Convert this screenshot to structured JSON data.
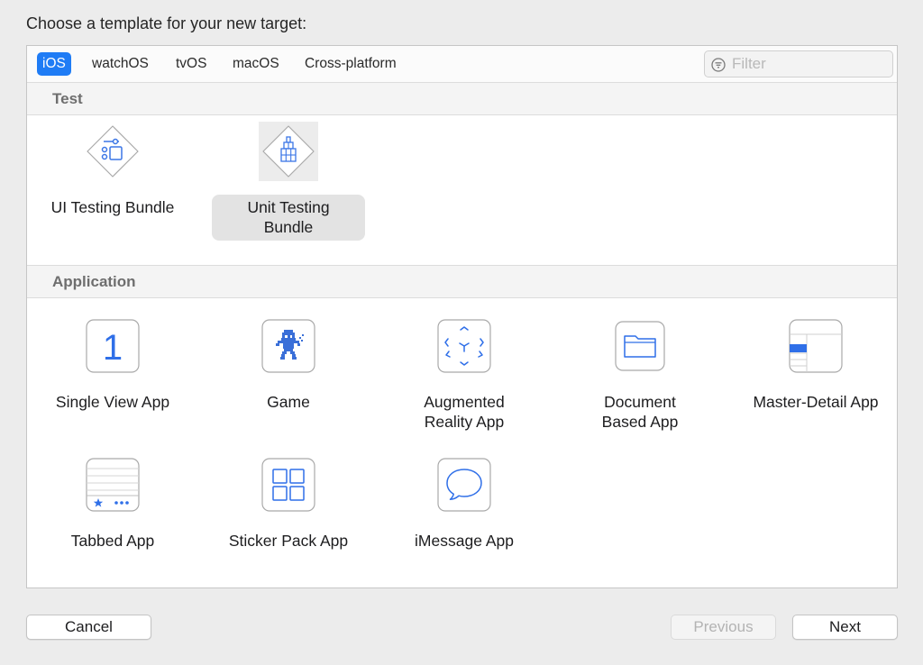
{
  "heading": "Choose a template for your new target:",
  "tabs": [
    {
      "label": "iOS",
      "selected": true
    },
    {
      "label": "watchOS",
      "selected": false
    },
    {
      "label": "tvOS",
      "selected": false
    },
    {
      "label": "macOS",
      "selected": false
    },
    {
      "label": "Cross-platform",
      "selected": false
    }
  ],
  "filter": {
    "placeholder": "Filter",
    "value": "",
    "icon": "filter-icon"
  },
  "sections": [
    {
      "title": "Test",
      "templates": [
        {
          "line1": "UI Testing Bundle",
          "line2": "",
          "icon": "ui-testing-bundle-icon",
          "selected": false
        },
        {
          "line1": "Unit Testing",
          "line2": "Bundle",
          "icon": "unit-testing-bundle-icon",
          "selected": true
        }
      ]
    },
    {
      "title": "Application",
      "templates": [
        {
          "line1": "Single View App",
          "line2": "",
          "icon": "single-view-app-icon",
          "icon_text": "1"
        },
        {
          "line1": "Game",
          "line2": "",
          "icon": "game-icon"
        },
        {
          "line1": "Augmented",
          "line2": "Reality App",
          "icon": "augmented-reality-app-icon"
        },
        {
          "line1": "Document",
          "line2": "Based App",
          "icon": "document-based-app-icon"
        },
        {
          "line1": "Master-Detail App",
          "line2": "",
          "icon": "master-detail-app-icon"
        },
        {
          "line1": "Tabbed App",
          "line2": "",
          "icon": "tabbed-app-icon"
        },
        {
          "line1": "Sticker Pack App",
          "line2": "",
          "icon": "sticker-pack-app-icon"
        },
        {
          "line1": "iMessage App",
          "line2": "",
          "icon": "imessage-app-icon"
        }
      ]
    }
  ],
  "buttons": {
    "cancel": "Cancel",
    "previous": "Previous",
    "next": "Next",
    "previous_enabled": false
  },
  "colors": {
    "accent": "#1f7cf5",
    "icon_blue": "#2f6fe8",
    "selection": "#e3e3e3"
  }
}
